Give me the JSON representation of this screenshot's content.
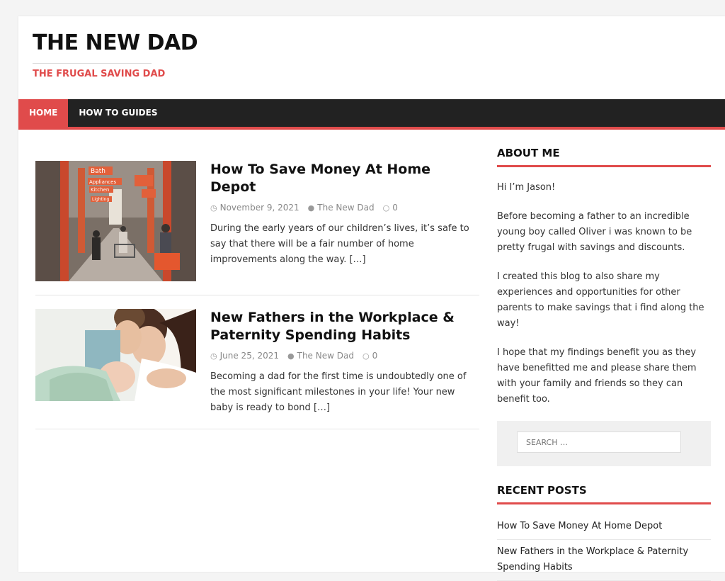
{
  "site": {
    "title": "THE NEW DAD",
    "description": "THE FRUGAL SAVING DAD",
    "accent_color": "#e04b4b"
  },
  "nav": {
    "items": [
      {
        "label": "HOME"
      },
      {
        "label": "HOW TO GUIDES"
      }
    ]
  },
  "posts": [
    {
      "title": "How To Save Money At Home Depot",
      "date": "November 9, 2021",
      "author": "The New Dad",
      "comments": "0",
      "excerpt": "During the early years of our children’s lives, it’s safe to say that there will be a fair number of home improvements along the way.",
      "more": "[…]",
      "thumbnail_signs": [
        "Bath",
        "Appliances",
        "Kitchen",
        "Lighting"
      ]
    },
    {
      "title": "New Fathers in the Workplace & Paternity Spending Habits",
      "date": "June 25, 2021",
      "author": "The New Dad",
      "comments": "0",
      "excerpt": "Becoming a dad for the first time is undoubtedly one of the most significant milestones in your life! Your new baby is ready to bond",
      "more": "[…]"
    }
  ],
  "sidebar": {
    "about": {
      "title": "ABOUT ME",
      "paragraphs": [
        "Hi I’m Jason!",
        "Before becoming a father to an incredible young boy called Oliver i was known to be pretty frugal with savings and discounts.",
        "I created this blog to also share my experiences and opportunities for other parents to make savings that i find along the way!",
        "I hope that my findings benefit you as they have benefitted me and please share them with your family and friends so they can benefit too."
      ]
    },
    "search": {
      "placeholder": "SEARCH …"
    },
    "recent": {
      "title": "RECENT POSTS",
      "items": [
        "How To Save Money At Home Depot",
        "New Fathers in the Workplace & Paternity Spending Habits"
      ]
    }
  },
  "icons": {
    "date": "clock-icon",
    "author": "user-icon",
    "comments": "comment-icon"
  }
}
